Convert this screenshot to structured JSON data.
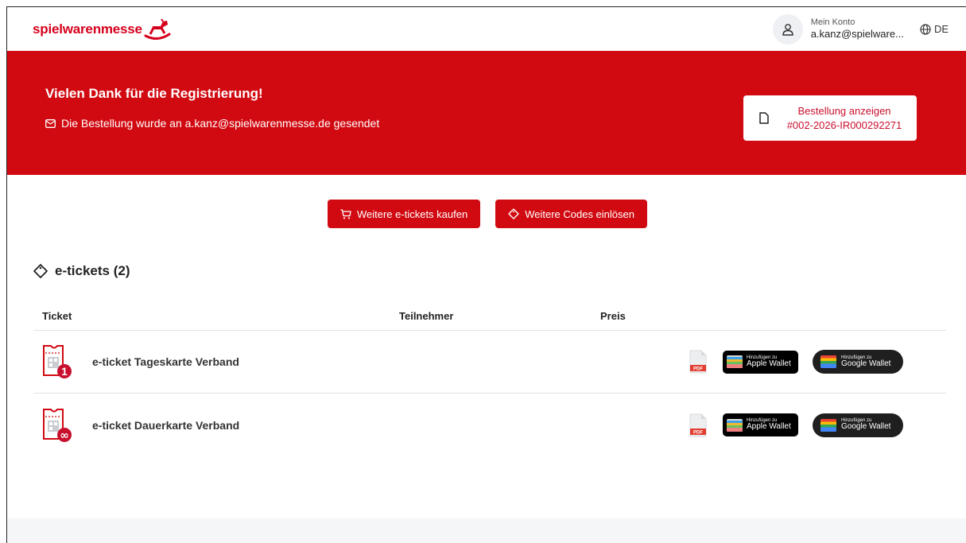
{
  "header": {
    "logo_text": "spielwarenmesse",
    "account_label": "Mein Konto",
    "account_email": "a.kanz@spielware...",
    "language": "DE"
  },
  "banner": {
    "title": "Vielen Dank für die Registrierung!",
    "subtitle": "Die Bestellung wurde an a.kanz@spielwarenmesse.de gesendet",
    "order_button_line1": "Bestellung anzeigen",
    "order_button_line2": "#002-2026-IR000292271"
  },
  "actions": {
    "buy_more": "Weitere e-tickets kaufen",
    "redeem_codes": "Weitere Codes einlösen"
  },
  "tickets": {
    "section_title": "e-tickets (2)",
    "columns": {
      "ticket": "Ticket",
      "participant": "Teilnehmer",
      "price": "Preis"
    },
    "rows": [
      {
        "name": "e-ticket Tageskarte Verband",
        "badge": "1",
        "participant": "",
        "price": ""
      },
      {
        "name": "e-ticket Dauerkarte Verband",
        "badge": "∞",
        "participant": "",
        "price": ""
      }
    ],
    "pdf_label": "PDF",
    "apple_small": "Hinzufügen zu",
    "apple_big": "Apple Wallet",
    "google_small": "Hinzufügen zu",
    "google_big": "Google Wallet"
  },
  "colors": {
    "brand_red": "#d10a11",
    "text_dark": "#222222"
  }
}
